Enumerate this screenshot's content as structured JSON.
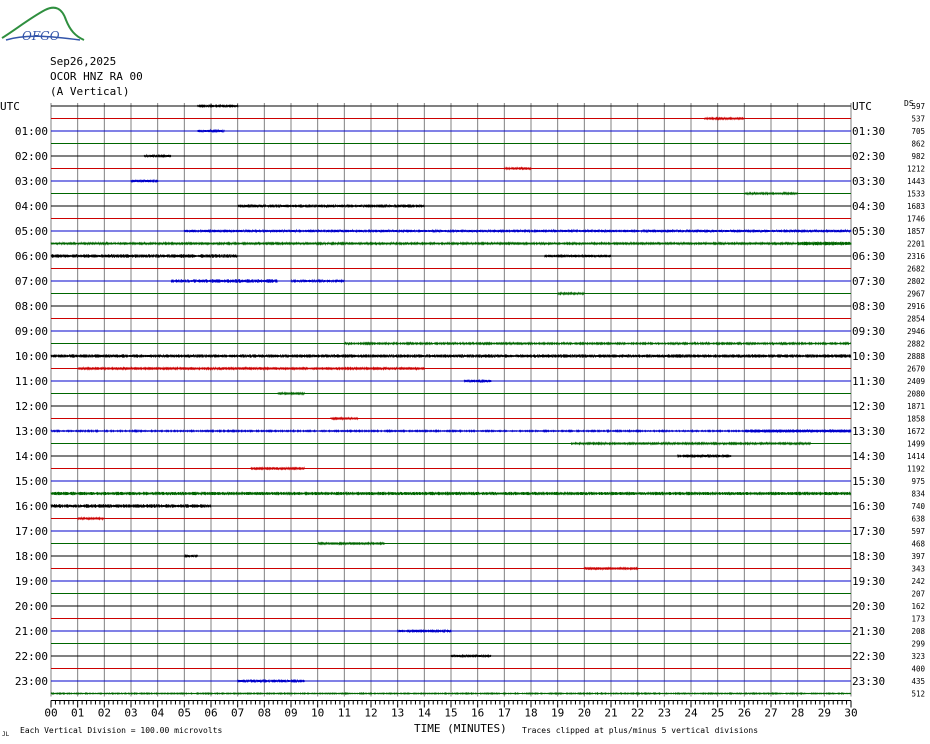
{
  "logo": {
    "text": "OFGO"
  },
  "header": {
    "date": "Sep26,2025",
    "station": "OCOR HNZ RA 00",
    "component": "(A Vertical)"
  },
  "left_axis_label": "UTC",
  "right_axis_label": "UTC",
  "ds_label": "DS",
  "footer": {
    "scale_note": "Each Vertical Division =  100.00 microvolts",
    "xlabel": "TIME (MINUTES)",
    "clip_note": "Traces clipped at plus/minus 5 vertical divisions"
  },
  "chart_data": {
    "type": "line",
    "title": "OCOR HNZ RA 00 (A Vertical)",
    "xlabel": "TIME (MINUTES)",
    "ylabel": "UTC",
    "x_ticks": [
      "00",
      "01",
      "02",
      "03",
      "04",
      "05",
      "06",
      "07",
      "08",
      "09",
      "10",
      "11",
      "12",
      "13",
      "14",
      "15",
      "16",
      "17",
      "18",
      "19",
      "20",
      "21",
      "22",
      "23",
      "24",
      "25",
      "26",
      "27",
      "28",
      "29",
      "30"
    ],
    "xlim": [
      0,
      30
    ],
    "left_hour_labels": [
      "UTC",
      "01:00",
      "02:00",
      "03:00",
      "04:00",
      "05:00",
      "06:00",
      "07:00",
      "08:00",
      "09:00",
      "10:00",
      "11:00",
      "12:00",
      "13:00",
      "14:00",
      "15:00",
      "16:00",
      "17:00",
      "18:00",
      "19:00",
      "20:00",
      "21:00",
      "22:00",
      "23:00"
    ],
    "right_hour_labels": [
      "UTC",
      "01:30",
      "02:30",
      "03:30",
      "04:30",
      "05:30",
      "06:30",
      "07:30",
      "08:30",
      "09:30",
      "10:30",
      "11:30",
      "12:30",
      "13:30",
      "14:30",
      "15:30",
      "16:30",
      "17:30",
      "18:30",
      "19:30",
      "20:30",
      "21:30",
      "22:30",
      "23:30"
    ],
    "trace_colors": [
      "#000000",
      "#cc0000",
      "#0000cc",
      "#006600"
    ],
    "ds_values": [
      "597",
      "537",
      "705",
      "862",
      "982",
      "1212",
      "1443",
      "1533",
      "1683",
      "1746",
      "1857",
      "2201",
      "2316",
      "2682",
      "2802",
      "2967",
      "2916",
      "2854",
      "2946",
      "2882",
      "2888",
      "2670",
      "2409",
      "2080",
      "1871",
      "1858",
      "1672",
      "1499",
      "1414",
      "1192",
      "975",
      "834",
      "740",
      "638",
      "597",
      "468",
      "397",
      "343",
      "242",
      "207",
      "162",
      "173",
      "208",
      "299",
      "323",
      "400",
      "435",
      "512"
    ],
    "grid": true,
    "trace_events": [
      {
        "trace": 0,
        "start": 5.5,
        "end": 7.0,
        "amp": 1.2
      },
      {
        "trace": 1,
        "start": 24.5,
        "end": 26.0,
        "amp": 0.8
      },
      {
        "trace": 2,
        "start": 5.5,
        "end": 6.5,
        "amp": 1.0
      },
      {
        "trace": 4,
        "start": 3.5,
        "end": 4.5,
        "amp": 1.0
      },
      {
        "trace": 5,
        "start": 17.0,
        "end": 18.0,
        "amp": 1.0
      },
      {
        "trace": 6,
        "start": 3.0,
        "end": 4.0,
        "amp": 1.0
      },
      {
        "trace": 7,
        "start": 26.0,
        "end": 28.0,
        "amp": 0.8
      },
      {
        "trace": 8,
        "start": 7.0,
        "end": 14.0,
        "amp": 1.2
      },
      {
        "trace": 10,
        "start": 5.0,
        "end": 30.0,
        "amp": 1.0
      },
      {
        "trace": 11,
        "start": 0.0,
        "end": 30.0,
        "amp": 0.8
      },
      {
        "trace": 11,
        "start": 28.0,
        "end": 30.0,
        "amp": 1.5
      },
      {
        "trace": 12,
        "start": 0.0,
        "end": 7.0,
        "amp": 1.5
      },
      {
        "trace": 12,
        "start": 18.5,
        "end": 21.0,
        "amp": 1.0
      },
      {
        "trace": 14,
        "start": 4.5,
        "end": 8.5,
        "amp": 1.5
      },
      {
        "trace": 14,
        "start": 9.0,
        "end": 11.0,
        "amp": 0.8
      },
      {
        "trace": 15,
        "start": 19.0,
        "end": 20.0,
        "amp": 0.8
      },
      {
        "trace": 19,
        "start": 11.0,
        "end": 30.0,
        "amp": 0.6
      },
      {
        "trace": 20,
        "start": 0.0,
        "end": 30.0,
        "amp": 1.4
      },
      {
        "trace": 21,
        "start": 1.0,
        "end": 14.0,
        "amp": 1.0
      },
      {
        "trace": 22,
        "start": 15.5,
        "end": 16.5,
        "amp": 1.2
      },
      {
        "trace": 23,
        "start": 8.5,
        "end": 9.5,
        "amp": 0.8
      },
      {
        "trace": 25,
        "start": 10.5,
        "end": 11.5,
        "amp": 0.8
      },
      {
        "trace": 26,
        "start": 0.0,
        "end": 30.0,
        "amp": 0.5
      },
      {
        "trace": 26,
        "start": 26.0,
        "end": 30.0,
        "amp": 1.2
      },
      {
        "trace": 27,
        "start": 19.5,
        "end": 28.5,
        "amp": 0.8
      },
      {
        "trace": 28,
        "start": 23.5,
        "end": 25.5,
        "amp": 1.2
      },
      {
        "trace": 29,
        "start": 7.5,
        "end": 9.5,
        "amp": 1.0
      },
      {
        "trace": 31,
        "start": 0.0,
        "end": 30.0,
        "amp": 1.4
      },
      {
        "trace": 32,
        "start": 0.0,
        "end": 6.0,
        "amp": 1.5
      },
      {
        "trace": 33,
        "start": 1.0,
        "end": 2.0,
        "amp": 0.8
      },
      {
        "trace": 35,
        "start": 10.0,
        "end": 12.5,
        "amp": 1.0
      },
      {
        "trace": 36,
        "start": 5.0,
        "end": 5.5,
        "amp": 0.8
      },
      {
        "trace": 37,
        "start": 20.0,
        "end": 22.0,
        "amp": 1.0
      },
      {
        "trace": 42,
        "start": 13.0,
        "end": 15.0,
        "amp": 1.2
      },
      {
        "trace": 44,
        "start": 15.0,
        "end": 16.5,
        "amp": 1.0
      },
      {
        "trace": 46,
        "start": 7.0,
        "end": 9.5,
        "amp": 1.2
      },
      {
        "trace": 47,
        "start": 0.0,
        "end": 30.0,
        "amp": 0.4
      }
    ]
  }
}
